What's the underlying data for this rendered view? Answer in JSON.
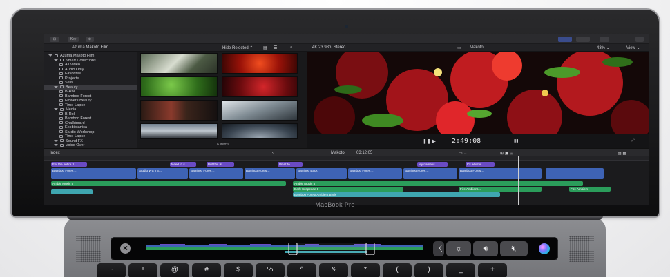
{
  "toolbar": {
    "lib_btn": "⊟",
    "key_btn": "Key",
    "import_btn": "⊕"
  },
  "browser_bar": {
    "library": "Azuma Makoto Film",
    "filter": "Hide Rejected ⌃",
    "items_count": "16 items"
  },
  "viewer": {
    "format": "4K 23.98p, Stereo",
    "title": "Makoto",
    "zoom": "43% ⌄",
    "view": "View ⌄",
    "timecode": "2:49:08"
  },
  "sidebar": {
    "items": [
      {
        "label": "Azuma Makoto Film",
        "indent": 0,
        "tri": true,
        "icon": true
      },
      {
        "label": "Smart Collections",
        "indent": 1,
        "tri": true,
        "icon": true
      },
      {
        "label": "All Video",
        "indent": 2,
        "tri": false,
        "icon": true
      },
      {
        "label": "Audio Only",
        "indent": 2,
        "tri": false,
        "icon": true
      },
      {
        "label": "Favorites",
        "indent": 2,
        "tri": false,
        "icon": true
      },
      {
        "label": "Projects",
        "indent": 2,
        "tri": false,
        "icon": true
      },
      {
        "label": "Stills",
        "indent": 2,
        "tri": false,
        "icon": true
      },
      {
        "label": "Beauty",
        "indent": 1,
        "tri": true,
        "icon": true,
        "selected": true
      },
      {
        "label": "B-Roll",
        "indent": 2,
        "tri": false,
        "icon": true
      },
      {
        "label": "Bamboo Forest",
        "indent": 2,
        "tri": false,
        "icon": true
      },
      {
        "label": "Flowers Beauty",
        "indent": 2,
        "tri": false,
        "icon": true
      },
      {
        "label": "Time-Lapse",
        "indent": 2,
        "tri": false,
        "icon": true
      },
      {
        "label": "Media",
        "indent": 1,
        "tri": true,
        "icon": true
      },
      {
        "label": "B-Roll",
        "indent": 2,
        "tri": false,
        "icon": true
      },
      {
        "label": "Bamboo Forest",
        "indent": 2,
        "tri": false,
        "icon": true
      },
      {
        "label": "Chalkboard",
        "indent": 2,
        "tri": false,
        "icon": true
      },
      {
        "label": "Exobiotanica",
        "indent": 2,
        "tri": false,
        "icon": true
      },
      {
        "label": "Studio Workshop",
        "indent": 2,
        "tri": false,
        "icon": true
      },
      {
        "label": "Time-Lapse",
        "indent": 2,
        "tri": false,
        "icon": true
      },
      {
        "label": "Sound FX",
        "indent": 1,
        "tri": true,
        "icon": true
      },
      {
        "label": "Voice Over",
        "indent": 1,
        "tri": true,
        "icon": true
      }
    ]
  },
  "timeline": {
    "index_label": "Index",
    "project": "Makoto",
    "duration": "03:12:05",
    "title_clips": [
      "For the entire fl…",
      "Need to s…",
      "But this is…",
      "Want to …",
      "My name is…",
      "It's what is…"
    ],
    "video_clips": [
      "Bamboo Fores…",
      "Studio WS TB…",
      "Bamboo Fores…",
      "Bamboo Fores…",
      "Bamboo Back",
      "Bamboo Fores…",
      "Bamboo Fores…",
      "Bamboo Fores…"
    ],
    "audio_clips": [
      "Ambie Music 5",
      "Ambie Music 5",
      "Dark Suspense 1",
      "Bamboo Forest Ambient Birds",
      "Fire Ambient…",
      "Fire Ambient"
    ]
  },
  "laptop": {
    "brand": "MacBook Pro"
  },
  "touchbar": {
    "close": "×",
    "chevron": "〈",
    "brightness": "☼",
    "volume": "🔊︎",
    "mute": "🔇︎"
  },
  "keys": [
    "~",
    "!",
    "@",
    "#",
    "$",
    "%",
    "^",
    "&",
    "*",
    "(",
    ")",
    "_",
    "+"
  ],
  "colors": {
    "title_clip": "#6a4bc4",
    "video_clip": "#3e63b5",
    "audio_clip": "#2b9d5b",
    "viewer_bg": "#000000"
  }
}
